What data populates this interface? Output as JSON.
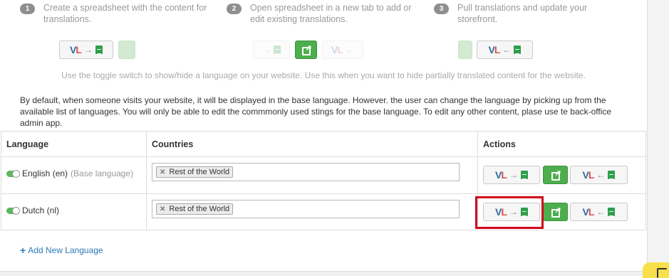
{
  "steps": [
    {
      "num": "1",
      "text": "Create a spreadsheet with the content for translations."
    },
    {
      "num": "2",
      "text": "Open spreadsheet in a new tab to add or edit existing translations."
    },
    {
      "num": "3",
      "text": "Pull translations and update your storefront."
    }
  ],
  "toggle_hint": "Use the toggle switch to show/hide a language on your website. Use this when you want to hide partially translated content for the website.",
  "info_note": "By default, when someone visits your website, it will be displayed in the base language. However. the user can change the language by picking up from the available list of languages. You will only be able to edit the commmonly used stings for the base language. To edit any other content, plase use te back-office admin app.",
  "table": {
    "headers": {
      "language": "Language",
      "countries": "Countries",
      "actions": "Actions"
    },
    "rows": [
      {
        "language": "English (en)",
        "base": "(Base language)",
        "country_tag": "Rest of the World",
        "enabled": true
      },
      {
        "language": "Dutch (nl)",
        "base": "",
        "country_tag": "Rest of the World",
        "enabled": true
      }
    ]
  },
  "brand": {
    "v": "V",
    "l": "L"
  },
  "arrows": {
    "push": "→",
    "pull": "←"
  },
  "add_language": "Add New Language",
  "icons": [
    "spreadsheet-icon",
    "external-link-icon",
    "plus-icon",
    "remove-icon",
    "toggle-icon"
  ],
  "colors": {
    "green": "#4cae4c",
    "link": "#2a7ab8",
    "highlight": "#d0011b"
  }
}
